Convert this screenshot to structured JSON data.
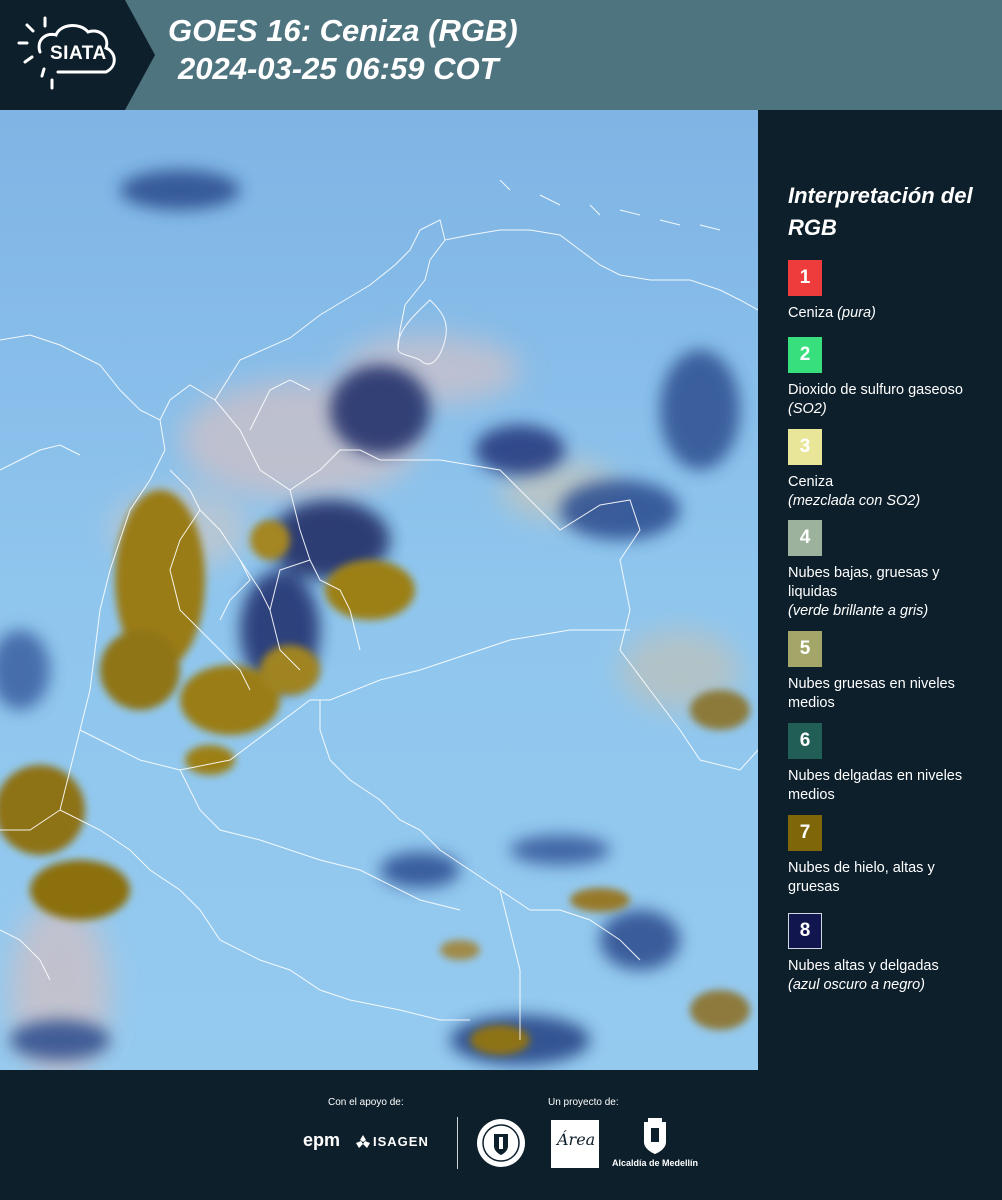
{
  "header": {
    "logo_text": "SIATA",
    "title_line1": "GOES 16: Ceniza (RGB)",
    "title_line2": "2024-03-25 06:59 COT"
  },
  "legend": {
    "title": "Interpretación del RGB",
    "items": [
      {
        "num": "1",
        "label": "Ceniza",
        "note": "(pura)",
        "color": "#ee3b3b"
      },
      {
        "num": "2",
        "label": "Dioxido de sulfuro gaseoso",
        "note": "(SO2)",
        "color": "#37e07c"
      },
      {
        "num": "3",
        "label": "Ceniza",
        "note": "(mezclada con SO2)",
        "color": "#e9e69a"
      },
      {
        "num": "4",
        "label": "Nubes bajas, gruesas y liquidas",
        "note": "(verde brillante a gris)",
        "color": "#9cb29c"
      },
      {
        "num": "5",
        "label": "Nubes gruesas en niveles medios",
        "note": "",
        "color": "#a4a568"
      },
      {
        "num": "6",
        "label": "Nubes delgadas en niveles medios",
        "note": "",
        "color": "#215f56"
      },
      {
        "num": "7",
        "label": "Nubes de hielo, altas y gruesas",
        "note": "",
        "color": "#7f6608"
      },
      {
        "num": "8",
        "label": "Nubes altas y delgadas",
        "note": "(azul oscuro a negro)",
        "color": "#12164f"
      }
    ]
  },
  "footer": {
    "support_label": "Con el apoyo de:",
    "project_label": "Un proyecto de:",
    "epm": "epm",
    "isagen": "ISAGEN",
    "area": "Área",
    "alcaldia": "Alcaldía de Medellín"
  }
}
